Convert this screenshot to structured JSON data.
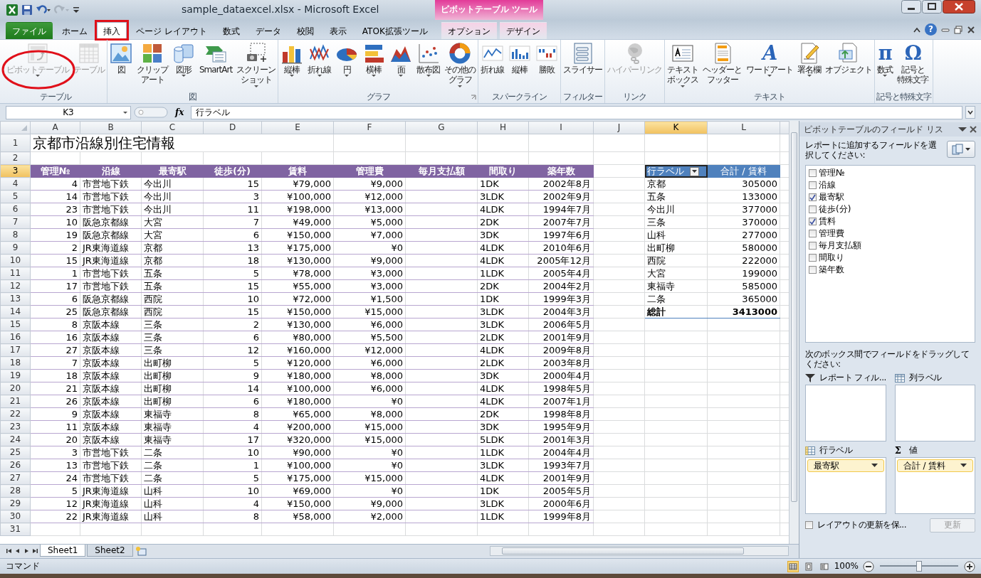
{
  "window": {
    "title": "sample_dataexcel.xlsx - Microsoft Excel",
    "context_group": "ピボットテーブル ツール",
    "help_glyph": "?"
  },
  "ribbon_tabs": [
    {
      "label": "ファイル",
      "kind": "file",
      "selected": false,
      "highlighted": false
    },
    {
      "label": "ホーム",
      "kind": "normal",
      "selected": false,
      "highlighted": false
    },
    {
      "label": "挿入",
      "kind": "normal",
      "selected": true,
      "highlighted": true
    },
    {
      "label": "ページ レイアウト",
      "kind": "normal",
      "selected": false,
      "highlighted": false
    },
    {
      "label": "数式",
      "kind": "normal",
      "selected": false,
      "highlighted": false
    },
    {
      "label": "データ",
      "kind": "normal",
      "selected": false,
      "highlighted": false
    },
    {
      "label": "校閲",
      "kind": "normal",
      "selected": false,
      "highlighted": false
    },
    {
      "label": "表示",
      "kind": "normal",
      "selected": false,
      "highlighted": false
    },
    {
      "label": "ATOK拡張ツール",
      "kind": "normal",
      "selected": false,
      "highlighted": false
    },
    {
      "label": "オプション",
      "kind": "context",
      "selected": false,
      "highlighted": false
    },
    {
      "label": "デザイン",
      "kind": "context",
      "selected": false,
      "highlighted": false
    }
  ],
  "ribbon_groups": [
    {
      "label": "テーブル",
      "launcher": false,
      "buttons": [
        {
          "lines": [
            "ピボットテーブル"
          ],
          "disabled": true,
          "dropdown": true,
          "highlighted": true
        },
        {
          "lines": [
            "テーブル"
          ],
          "disabled": true,
          "dropdown": false,
          "highlighted": false
        }
      ]
    },
    {
      "label": "図",
      "launcher": false,
      "buttons": [
        {
          "lines": [
            "図"
          ],
          "disabled": false,
          "dropdown": false,
          "highlighted": false
        },
        {
          "lines": [
            "クリップ",
            "アート"
          ],
          "disabled": false,
          "dropdown": false,
          "highlighted": false
        },
        {
          "lines": [
            "図形"
          ],
          "disabled": false,
          "dropdown": true,
          "highlighted": false
        },
        {
          "lines": [
            "SmartArt"
          ],
          "disabled": false,
          "dropdown": false,
          "highlighted": false
        },
        {
          "lines": [
            "スクリーン",
            "ショット"
          ],
          "disabled": false,
          "dropdown": true,
          "highlighted": false
        }
      ]
    },
    {
      "label": "グラフ",
      "launcher": true,
      "buttons": [
        {
          "lines": [
            "縦棒"
          ],
          "disabled": false,
          "dropdown": true,
          "highlighted": false
        },
        {
          "lines": [
            "折れ線"
          ],
          "disabled": false,
          "dropdown": true,
          "highlighted": false
        },
        {
          "lines": [
            "円"
          ],
          "disabled": false,
          "dropdown": true,
          "highlighted": false
        },
        {
          "lines": [
            "横棒"
          ],
          "disabled": false,
          "dropdown": true,
          "highlighted": false
        },
        {
          "lines": [
            "面"
          ],
          "disabled": false,
          "dropdown": true,
          "highlighted": false
        },
        {
          "lines": [
            "散布図"
          ],
          "disabled": false,
          "dropdown": true,
          "highlighted": false
        },
        {
          "lines": [
            "その他の",
            "グラフ"
          ],
          "disabled": false,
          "dropdown": true,
          "highlighted": false
        }
      ]
    },
    {
      "label": "スパークライン",
      "launcher": false,
      "buttons": [
        {
          "lines": [
            "折れ線"
          ],
          "disabled": false,
          "dropdown": false,
          "highlighted": false
        },
        {
          "lines": [
            "縦棒"
          ],
          "disabled": false,
          "dropdown": false,
          "highlighted": false
        },
        {
          "lines": [
            "勝敗"
          ],
          "disabled": false,
          "dropdown": false,
          "highlighted": false
        }
      ]
    },
    {
      "label": "フィルター",
      "launcher": false,
      "buttons": [
        {
          "lines": [
            "スライサー"
          ],
          "disabled": false,
          "dropdown": false,
          "highlighted": false
        }
      ]
    },
    {
      "label": "リンク",
      "launcher": false,
      "buttons": [
        {
          "lines": [
            "ハイパーリンク"
          ],
          "disabled": true,
          "dropdown": false,
          "highlighted": false
        }
      ]
    },
    {
      "label": "テキスト",
      "launcher": false,
      "buttons": [
        {
          "lines": [
            "テキスト",
            "ボックス"
          ],
          "disabled": false,
          "dropdown": true,
          "highlighted": false
        },
        {
          "lines": [
            "ヘッダーと",
            "フッター"
          ],
          "disabled": false,
          "dropdown": false,
          "highlighted": false
        },
        {
          "lines": [
            "ワードアート"
          ],
          "glyph": "A",
          "disabled": false,
          "dropdown": true,
          "highlighted": false
        },
        {
          "lines": [
            "署名欄"
          ],
          "disabled": false,
          "dropdown": true,
          "highlighted": false
        },
        {
          "lines": [
            "オブジェクト"
          ],
          "disabled": false,
          "dropdown": false,
          "highlighted": false
        }
      ]
    },
    {
      "label": "記号と特殊文字",
      "launcher": false,
      "buttons": [
        {
          "lines": [
            "数式"
          ],
          "glyph": "π",
          "disabled": false,
          "dropdown": true,
          "highlighted": false
        },
        {
          "lines": [
            "記号と",
            "特殊文字"
          ],
          "glyph": "Ω",
          "disabled": false,
          "dropdown": false,
          "highlighted": false
        }
      ]
    }
  ],
  "formula_bar": {
    "name_box": "K3",
    "function_glyph": "fx",
    "formula": "行ラベル"
  },
  "sheet": {
    "columns": [
      {
        "label": "A",
        "selected": false
      },
      {
        "label": "B",
        "selected": false
      },
      {
        "label": "C",
        "selected": false
      },
      {
        "label": "D",
        "selected": false
      },
      {
        "label": "E",
        "selected": false
      },
      {
        "label": "F",
        "selected": false
      },
      {
        "label": "G",
        "selected": false
      },
      {
        "label": "H",
        "selected": false
      },
      {
        "label": "I",
        "selected": false
      },
      {
        "label": "J",
        "selected": false
      },
      {
        "label": "K",
        "selected": true
      },
      {
        "label": "L",
        "selected": false
      }
    ],
    "row_headers": [
      {
        "label": "1",
        "selected": false
      },
      {
        "label": "2",
        "selected": false
      },
      {
        "label": "3",
        "selected": true
      },
      {
        "label": "4",
        "selected": false
      },
      {
        "label": "5",
        "selected": false
      },
      {
        "label": "6",
        "selected": false
      },
      {
        "label": "7",
        "selected": false
      },
      {
        "label": "8",
        "selected": false
      },
      {
        "label": "9",
        "selected": false
      },
      {
        "label": "10",
        "selected": false
      },
      {
        "label": "11",
        "selected": false
      },
      {
        "label": "12",
        "selected": false
      },
      {
        "label": "13",
        "selected": false
      },
      {
        "label": "14",
        "selected": false
      },
      {
        "label": "15",
        "selected": false
      },
      {
        "label": "16",
        "selected": false
      },
      {
        "label": "17",
        "selected": false
      },
      {
        "label": "18",
        "selected": false
      },
      {
        "label": "19",
        "selected": false
      },
      {
        "label": "20",
        "selected": false
      },
      {
        "label": "21",
        "selected": false
      },
      {
        "label": "22",
        "selected": false
      },
      {
        "label": "23",
        "selected": false
      },
      {
        "label": "24",
        "selected": false
      },
      {
        "label": "25",
        "selected": false
      },
      {
        "label": "26",
        "selected": false
      },
      {
        "label": "27",
        "selected": false
      },
      {
        "label": "28",
        "selected": false
      },
      {
        "label": "29",
        "selected": false
      },
      {
        "label": "30",
        "selected": false
      },
      {
        "label": "31",
        "selected": false
      }
    ],
    "title": "京都市沿線別住宅情報",
    "table_columns": [
      "管理№",
      "沿線",
      "最寄駅",
      "徒歩(分)",
      "賃料",
      "管理費",
      "毎月支払額",
      "間取り",
      "築年数"
    ],
    "table_rows": [
      [
        "4",
        "市営地下鉄",
        "今出川",
        "15",
        "¥79,000",
        "¥9,000",
        null,
        "1DK",
        "2002年8月"
      ],
      [
        "14",
        "市営地下鉄",
        "今出川",
        "3",
        "¥100,000",
        "¥12,000",
        null,
        "3LDK",
        "2002年9月"
      ],
      [
        "23",
        "市営地下鉄",
        "今出川",
        "11",
        "¥198,000",
        "¥13,000",
        null,
        "4LDK",
        "1994年7月"
      ],
      [
        "10",
        "阪急京都線",
        "大宮",
        "7",
        "¥49,000",
        "¥5,000",
        null,
        "2DK",
        "2007年7月"
      ],
      [
        "19",
        "阪急京都線",
        "大宮",
        "6",
        "¥150,000",
        "¥7,000",
        null,
        "3DK",
        "1997年6月"
      ],
      [
        "2",
        "JR東海道線",
        "京都",
        "13",
        "¥175,000",
        "¥0",
        null,
        "4LDK",
        "2010年6月"
      ],
      [
        "15",
        "JR東海道線",
        "京都",
        "18",
        "¥130,000",
        "¥9,000",
        null,
        "4LDK",
        "2005年12月"
      ],
      [
        "1",
        "市営地下鉄",
        "五条",
        "5",
        "¥78,000",
        "¥3,000",
        null,
        "1LDK",
        "2005年4月"
      ],
      [
        "17",
        "市営地下鉄",
        "五条",
        "15",
        "¥55,000",
        "¥3,000",
        null,
        "2DK",
        "2004年2月"
      ],
      [
        "6",
        "阪急京都線",
        "西院",
        "10",
        "¥72,000",
        "¥1,500",
        null,
        "1DK",
        "1999年3月"
      ],
      [
        "25",
        "阪急京都線",
        "西院",
        "15",
        "¥150,000",
        "¥15,000",
        null,
        "3LDK",
        "2004年3月"
      ],
      [
        "8",
        "京阪本線",
        "三条",
        "2",
        "¥130,000",
        "¥6,000",
        null,
        "3LDK",
        "2006年5月"
      ],
      [
        "16",
        "京阪本線",
        "三条",
        "6",
        "¥80,000",
        "¥5,500",
        null,
        "2LDK",
        "2001年9月"
      ],
      [
        "27",
        "京阪本線",
        "三条",
        "12",
        "¥160,000",
        "¥12,000",
        null,
        "4LDK",
        "2009年8月"
      ],
      [
        "7",
        "京阪本線",
        "出町柳",
        "5",
        "¥120,000",
        "¥6,000",
        null,
        "2LDK",
        "2003年8月"
      ],
      [
        "18",
        "京阪本線",
        "出町柳",
        "9",
        "¥180,000",
        "¥8,000",
        null,
        "3DK",
        "2000年4月"
      ],
      [
        "21",
        "京阪本線",
        "出町柳",
        "14",
        "¥100,000",
        "¥6,000",
        null,
        "4LDK",
        "1998年5月"
      ],
      [
        "26",
        "京阪本線",
        "出町柳",
        "6",
        "¥180,000",
        "¥0",
        null,
        "4LDK",
        "2007年1月"
      ],
      [
        "9",
        "京阪本線",
        "東福寺",
        "8",
        "¥65,000",
        "¥8,000",
        null,
        "2DK",
        "1998年8月"
      ],
      [
        "11",
        "京阪本線",
        "東福寺",
        "4",
        "¥200,000",
        "¥15,000",
        null,
        "3DK",
        "1995年9月"
      ],
      [
        "20",
        "京阪本線",
        "東福寺",
        "17",
        "¥320,000",
        "¥15,000",
        null,
        "5LDK",
        "2001年3月"
      ],
      [
        "3",
        "市営地下鉄",
        "二条",
        "10",
        "¥90,000",
        "¥0",
        null,
        "1LDK",
        "2004年4月"
      ],
      [
        "13",
        "市営地下鉄",
        "二条",
        "1",
        "¥100,000",
        "¥0",
        null,
        "3LDK",
        "1993年7月"
      ],
      [
        "24",
        "市営地下鉄",
        "二条",
        "5",
        "¥175,000",
        "¥15,000",
        null,
        "4LDK",
        "2001年9月"
      ],
      [
        "5",
        "JR東海道線",
        "山科",
        "10",
        "¥69,000",
        "¥0",
        null,
        "1DK",
        "2005年5月"
      ],
      [
        "12",
        "JR東海道線",
        "山科",
        "4",
        "¥150,000",
        "¥9,000",
        null,
        "3LDK",
        "2000年6月"
      ],
      [
        "22",
        "JR東海道線",
        "山科",
        "8",
        "¥58,000",
        "¥2,000",
        null,
        "1LDK",
        "1999年8月"
      ]
    ],
    "pivot": {
      "row_label": "行ラベル",
      "value_label": "合計 / 賃料",
      "rows": [
        {
          "label": "京都",
          "value": "305000"
        },
        {
          "label": "五条",
          "value": "133000"
        },
        {
          "label": "今出川",
          "value": "377000"
        },
        {
          "label": "三条",
          "value": "370000"
        },
        {
          "label": "山科",
          "value": "277000"
        },
        {
          "label": "出町柳",
          "value": "580000"
        },
        {
          "label": "西院",
          "value": "222000"
        },
        {
          "label": "大宮",
          "value": "199000"
        },
        {
          "label": "東福寺",
          "value": "585000"
        },
        {
          "label": "二条",
          "value": "365000"
        }
      ],
      "total_label": "総計",
      "total_value": "3413000"
    }
  },
  "sheet_tabs": [
    {
      "label": "Sheet1",
      "selected": true
    },
    {
      "label": "Sheet2",
      "selected": false
    }
  ],
  "field_list": {
    "title": "ピボットテーブルのフィールド リス",
    "instruction": "レポートに追加するフィールドを選択してください:",
    "fields": [
      {
        "label": "管理№",
        "checked": false
      },
      {
        "label": "沿線",
        "checked": false
      },
      {
        "label": "最寄駅",
        "checked": true
      },
      {
        "label": "徒歩(分)",
        "checked": false
      },
      {
        "label": "賃料",
        "checked": true
      },
      {
        "label": "管理費",
        "checked": false
      },
      {
        "label": "毎月支払額",
        "checked": false
      },
      {
        "label": "間取り",
        "checked": false
      },
      {
        "label": "築年数",
        "checked": false
      }
    ],
    "drag_instruction": "次のボックス間でフィールドをドラッグしてください:",
    "areas": [
      {
        "kind": "filter",
        "label": "レポート フィル..."
      },
      {
        "kind": "columns",
        "label": "列ラベル"
      },
      {
        "kind": "rows",
        "label": "行ラベル",
        "items": [
          "最寄駅"
        ]
      },
      {
        "kind": "values",
        "label": "値",
        "glyph": "Σ",
        "items": [
          "合計 / 賃料"
        ]
      }
    ],
    "defer_label": "レイアウトの更新を保...",
    "defer_checked": false,
    "update_button": {
      "label": "更新",
      "disabled": true
    }
  },
  "status_bar": {
    "mode": "コマンド",
    "views": [
      {
        "selected": true
      },
      {
        "selected": false
      },
      {
        "selected": false
      }
    ],
    "zoom": "100%",
    "zoom_slider": {
      "level": 0.5
    }
  }
}
